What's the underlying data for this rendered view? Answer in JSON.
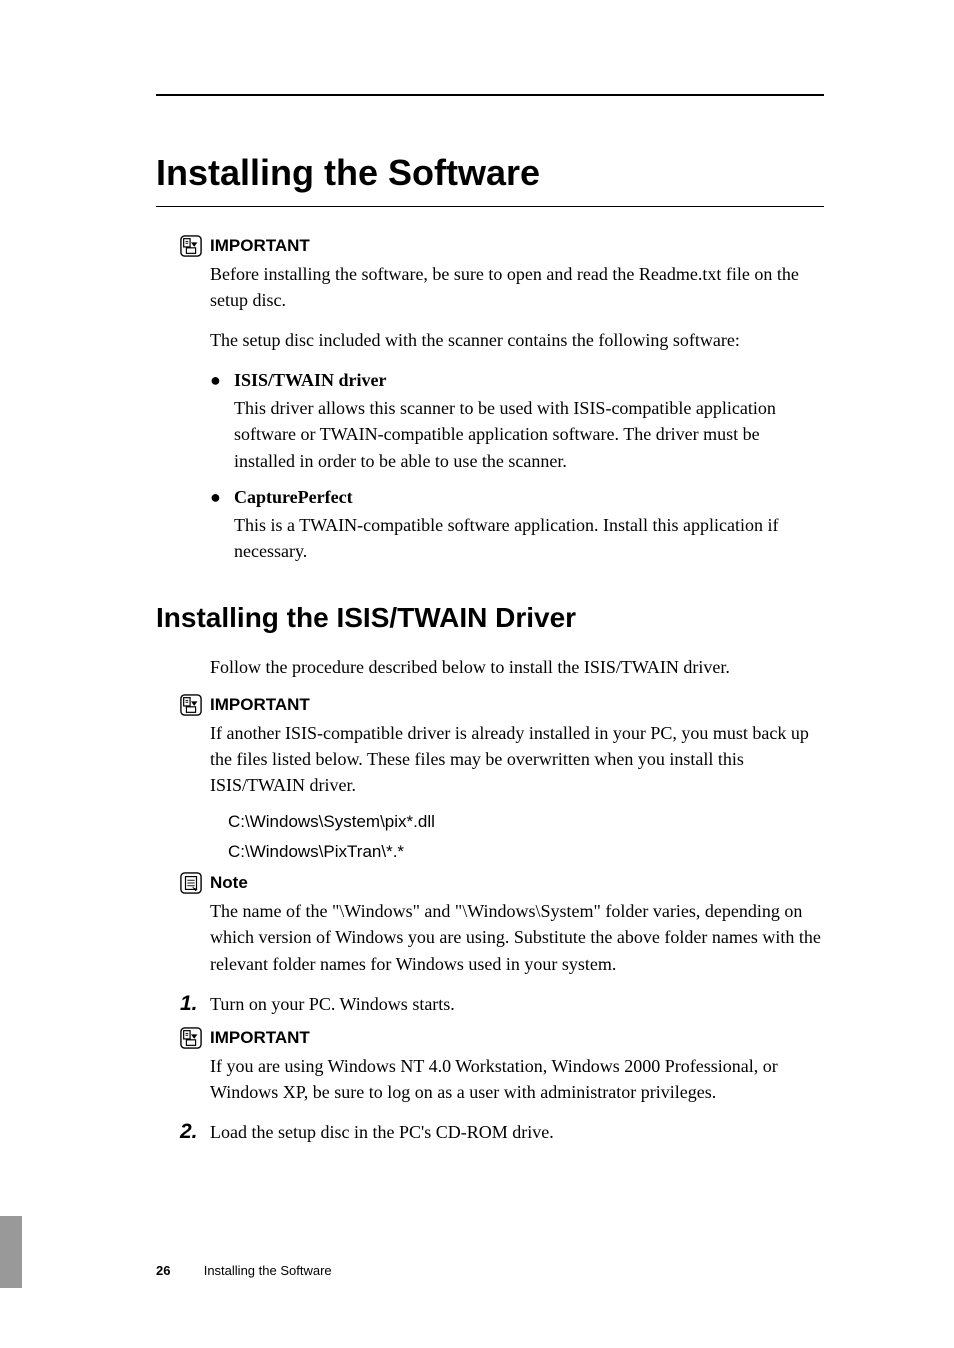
{
  "title": "Installing the Software",
  "important1": {
    "label": "IMPORTANT",
    "text": "Before installing the software, be sure to open and read the Readme.txt file on the setup disc."
  },
  "intro": "The setup disc included with the scanner contains the following software:",
  "bullets": [
    {
      "label": "ISIS/TWAIN driver",
      "desc": "This driver allows this scanner to be used with ISIS-compatible application software or TWAIN-compatible application software. The driver must be installed in order to be able to use the scanner."
    },
    {
      "label": "CapturePerfect",
      "desc": "This is a TWAIN-compatible software application. Install this application if necessary."
    }
  ],
  "subtitle": "Installing the ISIS/TWAIN Driver",
  "subintro": "Follow the procedure described below to install the ISIS/TWAIN driver.",
  "important2": {
    "label": "IMPORTANT",
    "text": "If another ISIS-compatible driver is already installed in your PC, you must back up the files listed below. These files may be overwritten when you install this ISIS/TWAIN driver."
  },
  "paths": [
    "C:\\Windows\\System\\pix*.dll",
    "C:\\Windows\\PixTran\\*.*"
  ],
  "note": {
    "label": "Note",
    "text": "The name of the \"\\Windows\" and \"\\Windows\\System\" folder varies, depending on which version of Windows you are using. Substitute the above folder names with the relevant folder names for Windows used in your system."
  },
  "steps": [
    {
      "num": "1.",
      "text": "Turn on your PC. Windows starts."
    }
  ],
  "important3": {
    "label": "IMPORTANT",
    "text": "If you are using Windows NT 4.0 Workstation, Windows 2000 Professional, or Windows XP, be sure to log on as a user with administrator privileges."
  },
  "steps2": [
    {
      "num": "2.",
      "text": "Load the setup disc in the PC's CD-ROM drive."
    }
  ],
  "footer": {
    "page": "26",
    "label": "Installing the Software"
  }
}
